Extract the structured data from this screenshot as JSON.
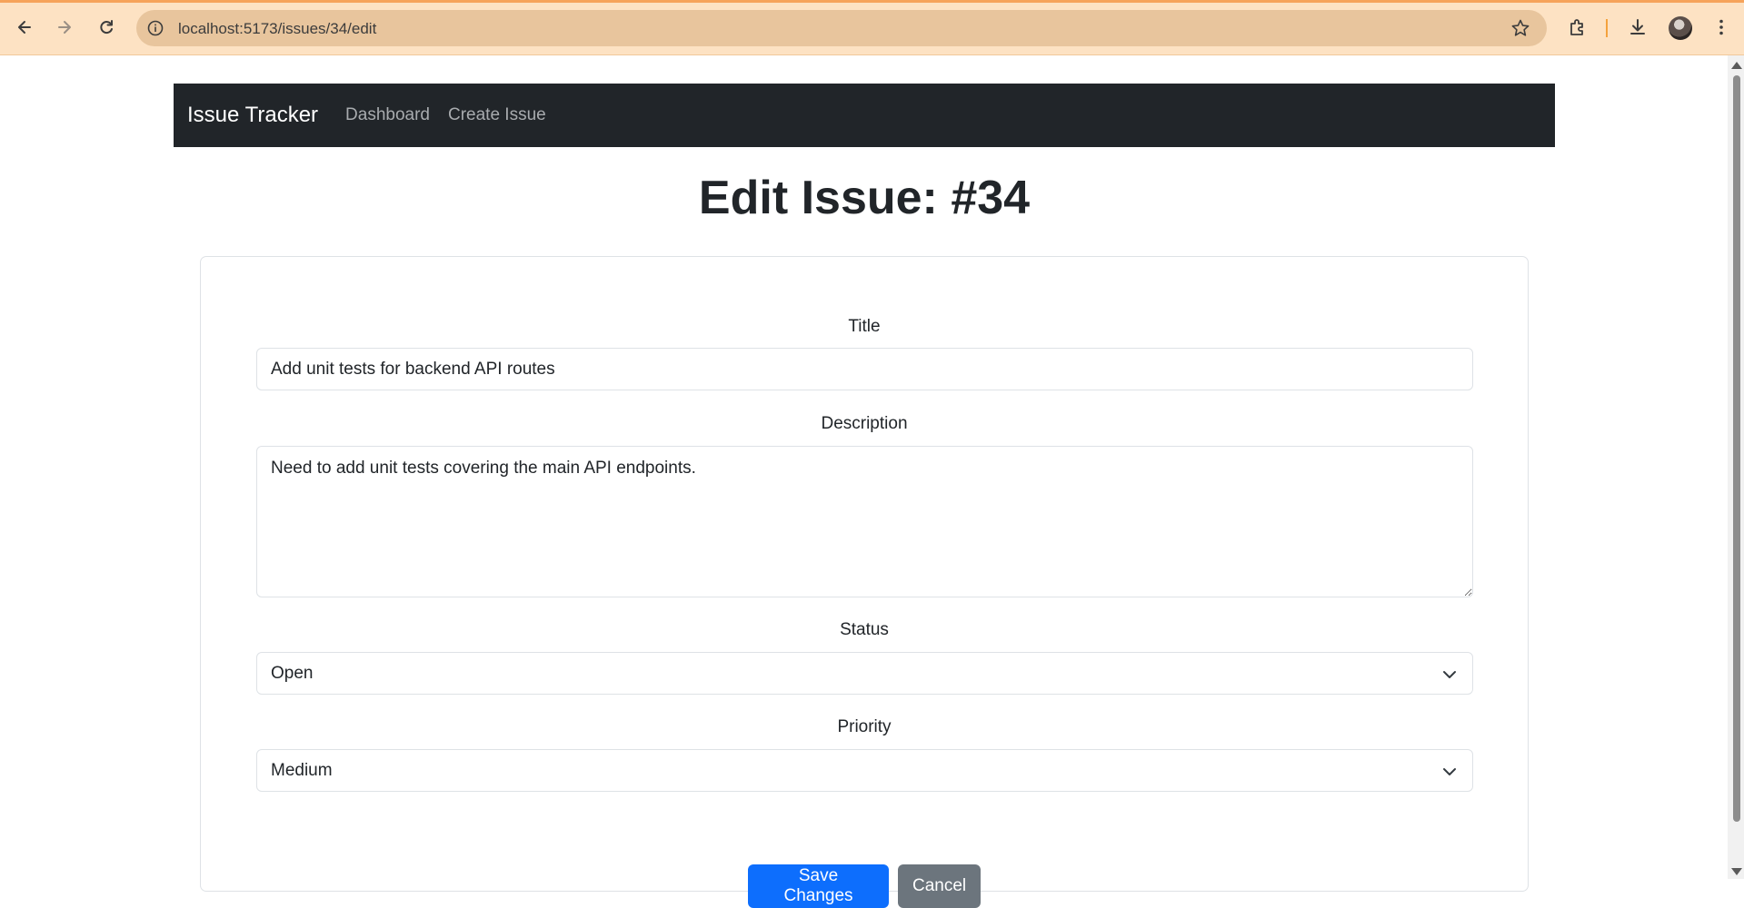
{
  "browser": {
    "url": "localhost:5173/issues/34/edit"
  },
  "navbar": {
    "brand": "Issue Tracker",
    "links": [
      "Dashboard",
      "Create Issue"
    ]
  },
  "page": {
    "title": "Edit Issue: #34"
  },
  "form": {
    "title_label": "Title",
    "title_value": "Add unit tests for backend API routes",
    "description_label": "Description",
    "description_value": "Need to add unit tests covering the main API endpoints.",
    "status_label": "Status",
    "status_value": "Open",
    "priority_label": "Priority",
    "priority_value": "Medium",
    "save_label": "Save Changes",
    "cancel_label": "Cancel"
  },
  "colors": {
    "navbar_bg": "#212529",
    "primary": "#0d6efd",
    "secondary": "#6c757d",
    "browser_toolbar": "#fde2c3"
  }
}
